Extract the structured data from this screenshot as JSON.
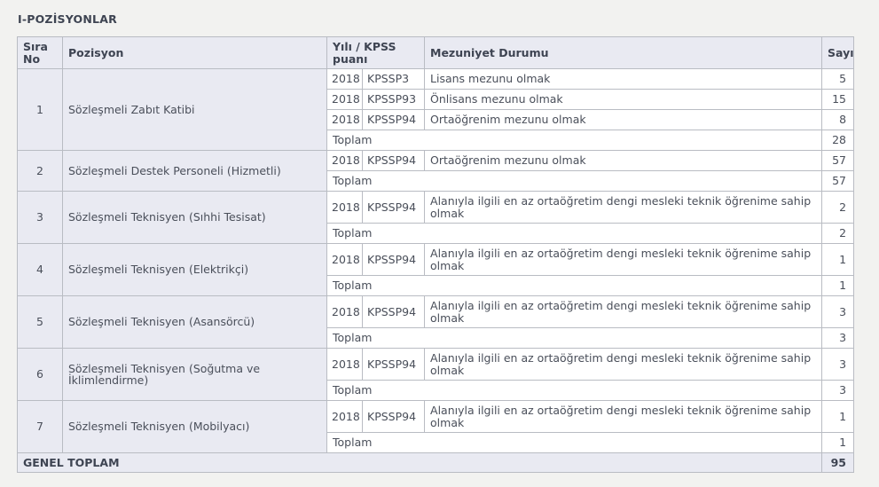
{
  "section_title": "I-POZİSYONLAR",
  "headers": {
    "sira_no": "Sıra No",
    "pozisyon": "Pozisyon",
    "yili_kpss": "Yılı / KPSS puanı",
    "mezuniyet": "Mezuniyet Durumu",
    "sayi": "Sayı"
  },
  "groups": [
    {
      "no": "1",
      "position": "Sözleşmeli Zabıt Katibi",
      "rows": [
        {
          "year": "2018",
          "kpss": "KPSSP3",
          "education": "Lisans mezunu olmak",
          "count": "5"
        },
        {
          "year": "2018",
          "kpss": "KPSSP93",
          "education": "Önlisans mezunu olmak",
          "count": "15"
        },
        {
          "year": "2018",
          "kpss": "KPSSP94",
          "education": "Ortaöğrenim mezunu olmak",
          "count": "8"
        }
      ],
      "total_label": "Toplam",
      "total": "28"
    },
    {
      "no": "2",
      "position": "Sözleşmeli Destek Personeli (Hizmetli)",
      "rows": [
        {
          "year": "2018",
          "kpss": "KPSSP94",
          "education": "Ortaöğrenim mezunu olmak",
          "count": "57"
        }
      ],
      "total_label": "Toplam",
      "total": "57"
    },
    {
      "no": "3",
      "position": "Sözleşmeli Teknisyen (Sıhhi Tesisat)",
      "rows": [
        {
          "year": "2018",
          "kpss": "KPSSP94",
          "education": "Alanıyla ilgili en az ortaöğretim dengi mesleki teknik öğrenime sahip olmak",
          "count": "2"
        }
      ],
      "total_label": "Toplam",
      "total": "2"
    },
    {
      "no": "4",
      "position": "Sözleşmeli Teknisyen (Elektrikçi)",
      "rows": [
        {
          "year": "2018",
          "kpss": "KPSSP94",
          "education": "Alanıyla ilgili en az ortaöğretim dengi mesleki teknik öğrenime sahip olmak",
          "count": "1"
        }
      ],
      "total_label": "Toplam",
      "total": "1"
    },
    {
      "no": "5",
      "position": "Sözleşmeli Teknisyen (Asansörcü)",
      "rows": [
        {
          "year": "2018",
          "kpss": "KPSSP94",
          "education": "Alanıyla ilgili en az ortaöğretim dengi mesleki teknik öğrenime sahip olmak",
          "count": "3"
        }
      ],
      "total_label": "Toplam",
      "total": "3"
    },
    {
      "no": "6",
      "position": "Sözleşmeli Teknisyen (Soğutma ve İklimlendirme)",
      "rows": [
        {
          "year": "2018",
          "kpss": "KPSSP94",
          "education": "Alanıyla ilgili en az ortaöğretim dengi mesleki teknik öğrenime sahip olmak",
          "count": "3"
        }
      ],
      "total_label": "Toplam",
      "total": "3"
    },
    {
      "no": "7",
      "position": "Sözleşmeli Teknisyen (Mobilyacı)",
      "rows": [
        {
          "year": "2018",
          "kpss": "KPSSP94",
          "education": "Alanıyla ilgili en az ortaöğretim dengi mesleki teknik öğrenime sahip olmak",
          "count": "1"
        }
      ],
      "total_label": "Toplam",
      "total": "1"
    }
  ],
  "grand_total_label": "GENEL TOPLAM",
  "grand_total": "95"
}
